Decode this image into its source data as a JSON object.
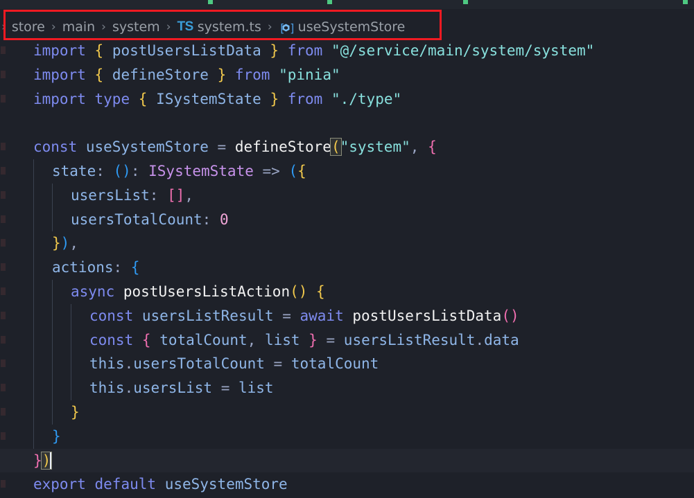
{
  "window": {
    "background_color": "#1e2129",
    "accent_color": "#3b9dd8",
    "annotation_color": "#f01a22"
  },
  "tabstrip": {
    "visible_fragment": true
  },
  "breadcrumb": {
    "overflow_caret": "›",
    "separator": "›",
    "items": [
      {
        "label": "store",
        "icon": null
      },
      {
        "label": "main",
        "icon": null
      },
      {
        "label": "system",
        "icon": null
      },
      {
        "label": "system.ts",
        "icon": "typescript-file-icon",
        "icon_text": "TS"
      },
      {
        "label": "useSystemStore",
        "icon": "symbol-variable-icon"
      }
    ]
  },
  "annotation": {
    "name": "red-highlight-rectangle",
    "target": "breadcrumb"
  },
  "editor": {
    "language": "typescript",
    "active_line_index": 17,
    "cursor_after": ")",
    "lines": [
      {
        "indent": 0,
        "tokens": [
          {
            "t": "import",
            "c": "kw"
          },
          {
            "t": " ",
            "c": "plain"
          },
          {
            "t": "{",
            "c": "br-y"
          },
          {
            "t": " ",
            "c": "plain"
          },
          {
            "t": "postUsersListData",
            "c": "id"
          },
          {
            "t": " ",
            "c": "plain"
          },
          {
            "t": "}",
            "c": "br-y"
          },
          {
            "t": " ",
            "c": "plain"
          },
          {
            "t": "from",
            "c": "kw"
          },
          {
            "t": " ",
            "c": "plain"
          },
          {
            "t": "\"@/service/main/system/system\"",
            "c": "str"
          }
        ]
      },
      {
        "indent": 0,
        "tokens": [
          {
            "t": "import",
            "c": "kw"
          },
          {
            "t": " ",
            "c": "plain"
          },
          {
            "t": "{",
            "c": "br-y"
          },
          {
            "t": " ",
            "c": "plain"
          },
          {
            "t": "defineStore",
            "c": "id"
          },
          {
            "t": " ",
            "c": "plain"
          },
          {
            "t": "}",
            "c": "br-y"
          },
          {
            "t": " ",
            "c": "plain"
          },
          {
            "t": "from",
            "c": "kw"
          },
          {
            "t": " ",
            "c": "plain"
          },
          {
            "t": "\"pinia\"",
            "c": "str"
          }
        ]
      },
      {
        "indent": 0,
        "tokens": [
          {
            "t": "import",
            "c": "kw"
          },
          {
            "t": " ",
            "c": "plain"
          },
          {
            "t": "type",
            "c": "kw"
          },
          {
            "t": " ",
            "c": "plain"
          },
          {
            "t": "{",
            "c": "br-y"
          },
          {
            "t": " ",
            "c": "plain"
          },
          {
            "t": "ISystemState",
            "c": "id"
          },
          {
            "t": " ",
            "c": "plain"
          },
          {
            "t": "}",
            "c": "br-y"
          },
          {
            "t": " ",
            "c": "plain"
          },
          {
            "t": "from",
            "c": "kw"
          },
          {
            "t": " ",
            "c": "plain"
          },
          {
            "t": "\"./type\"",
            "c": "str"
          }
        ]
      },
      {
        "indent": 0,
        "tokens": []
      },
      {
        "indent": 0,
        "tokens": [
          {
            "t": "const",
            "c": "kw"
          },
          {
            "t": " ",
            "c": "plain"
          },
          {
            "t": "useSystemStore",
            "c": "id"
          },
          {
            "t": " ",
            "c": "plain"
          },
          {
            "t": "=",
            "c": "op"
          },
          {
            "t": " ",
            "c": "plain"
          },
          {
            "t": "defineStore",
            "c": "fn"
          },
          {
            "t": "(",
            "c": "br-y",
            "match": true
          },
          {
            "t": "\"system\"",
            "c": "str"
          },
          {
            "t": ",",
            "c": "op"
          },
          {
            "t": " ",
            "c": "plain"
          },
          {
            "t": "{",
            "c": "br-p"
          }
        ]
      },
      {
        "indent": 1,
        "tokens": [
          {
            "t": "state",
            "c": "id"
          },
          {
            "t": ":",
            "c": "op"
          },
          {
            "t": " ",
            "c": "plain"
          },
          {
            "t": "()",
            "c": "br-b"
          },
          {
            "t": ":",
            "c": "op"
          },
          {
            "t": " ",
            "c": "plain"
          },
          {
            "t": "ISystemState",
            "c": "typ"
          },
          {
            "t": " ",
            "c": "plain"
          },
          {
            "t": "=>",
            "c": "op"
          },
          {
            "t": " ",
            "c": "plain"
          },
          {
            "t": "(",
            "c": "br-b"
          },
          {
            "t": "{",
            "c": "br-y"
          }
        ]
      },
      {
        "indent": 2,
        "tokens": [
          {
            "t": "usersList",
            "c": "id"
          },
          {
            "t": ":",
            "c": "op"
          },
          {
            "t": " ",
            "c": "plain"
          },
          {
            "t": "[]",
            "c": "br-p"
          },
          {
            "t": ",",
            "c": "op"
          }
        ]
      },
      {
        "indent": 2,
        "tokens": [
          {
            "t": "usersTotalCount",
            "c": "id"
          },
          {
            "t": ":",
            "c": "op"
          },
          {
            "t": " ",
            "c": "plain"
          },
          {
            "t": "0",
            "c": "num"
          }
        ]
      },
      {
        "indent": 1,
        "tokens": [
          {
            "t": "}",
            "c": "br-y"
          },
          {
            "t": ")",
            "c": "br-b"
          },
          {
            "t": ",",
            "c": "op"
          }
        ]
      },
      {
        "indent": 1,
        "tokens": [
          {
            "t": "actions",
            "c": "id"
          },
          {
            "t": ":",
            "c": "op"
          },
          {
            "t": " ",
            "c": "plain"
          },
          {
            "t": "{",
            "c": "br-b"
          }
        ]
      },
      {
        "indent": 2,
        "tokens": [
          {
            "t": "async",
            "c": "kw"
          },
          {
            "t": " ",
            "c": "plain"
          },
          {
            "t": "postUsersListAction",
            "c": "fn"
          },
          {
            "t": "()",
            "c": "br-y"
          },
          {
            "t": " ",
            "c": "plain"
          },
          {
            "t": "{",
            "c": "br-y"
          }
        ]
      },
      {
        "indent": 3,
        "tokens": [
          {
            "t": "const",
            "c": "kw"
          },
          {
            "t": " ",
            "c": "plain"
          },
          {
            "t": "usersListResult",
            "c": "id"
          },
          {
            "t": " ",
            "c": "plain"
          },
          {
            "t": "=",
            "c": "op"
          },
          {
            "t": " ",
            "c": "plain"
          },
          {
            "t": "await",
            "c": "kw"
          },
          {
            "t": " ",
            "c": "plain"
          },
          {
            "t": "postUsersListData",
            "c": "fn"
          },
          {
            "t": "()",
            "c": "br-p"
          }
        ]
      },
      {
        "indent": 3,
        "tokens": [
          {
            "t": "const",
            "c": "kw"
          },
          {
            "t": " ",
            "c": "plain"
          },
          {
            "t": "{",
            "c": "br-p"
          },
          {
            "t": " ",
            "c": "plain"
          },
          {
            "t": "totalCount",
            "c": "id"
          },
          {
            "t": ",",
            "c": "op"
          },
          {
            "t": " ",
            "c": "plain"
          },
          {
            "t": "list",
            "c": "id"
          },
          {
            "t": " ",
            "c": "plain"
          },
          {
            "t": "}",
            "c": "br-p"
          },
          {
            "t": " ",
            "c": "plain"
          },
          {
            "t": "=",
            "c": "op"
          },
          {
            "t": " ",
            "c": "plain"
          },
          {
            "t": "usersListResult",
            "c": "id"
          },
          {
            "t": ".",
            "c": "op"
          },
          {
            "t": "data",
            "c": "id"
          }
        ]
      },
      {
        "indent": 3,
        "tokens": [
          {
            "t": "this",
            "c": "id"
          },
          {
            "t": ".",
            "c": "op"
          },
          {
            "t": "usersTotalCount",
            "c": "id"
          },
          {
            "t": " ",
            "c": "plain"
          },
          {
            "t": "=",
            "c": "op"
          },
          {
            "t": " ",
            "c": "plain"
          },
          {
            "t": "totalCount",
            "c": "id"
          }
        ]
      },
      {
        "indent": 3,
        "tokens": [
          {
            "t": "this",
            "c": "id"
          },
          {
            "t": ".",
            "c": "op"
          },
          {
            "t": "usersList",
            "c": "id"
          },
          {
            "t": " ",
            "c": "plain"
          },
          {
            "t": "=",
            "c": "op"
          },
          {
            "t": " ",
            "c": "plain"
          },
          {
            "t": "list",
            "c": "id"
          }
        ]
      },
      {
        "indent": 2,
        "tokens": [
          {
            "t": "}",
            "c": "br-y"
          }
        ]
      },
      {
        "indent": 1,
        "tokens": [
          {
            "t": "}",
            "c": "br-b"
          }
        ]
      },
      {
        "indent": 0,
        "active": true,
        "tokens": [
          {
            "t": "}",
            "c": "br-p"
          },
          {
            "t": ")",
            "c": "br-y",
            "match": true
          },
          {
            "t": "",
            "c": "cursor"
          }
        ]
      },
      {
        "indent": 0,
        "tokens": [
          {
            "t": "export",
            "c": "kw"
          },
          {
            "t": " ",
            "c": "plain"
          },
          {
            "t": "default",
            "c": "kw"
          },
          {
            "t": " ",
            "c": "plain"
          },
          {
            "t": "useSystemStore",
            "c": "id"
          }
        ]
      }
    ]
  }
}
